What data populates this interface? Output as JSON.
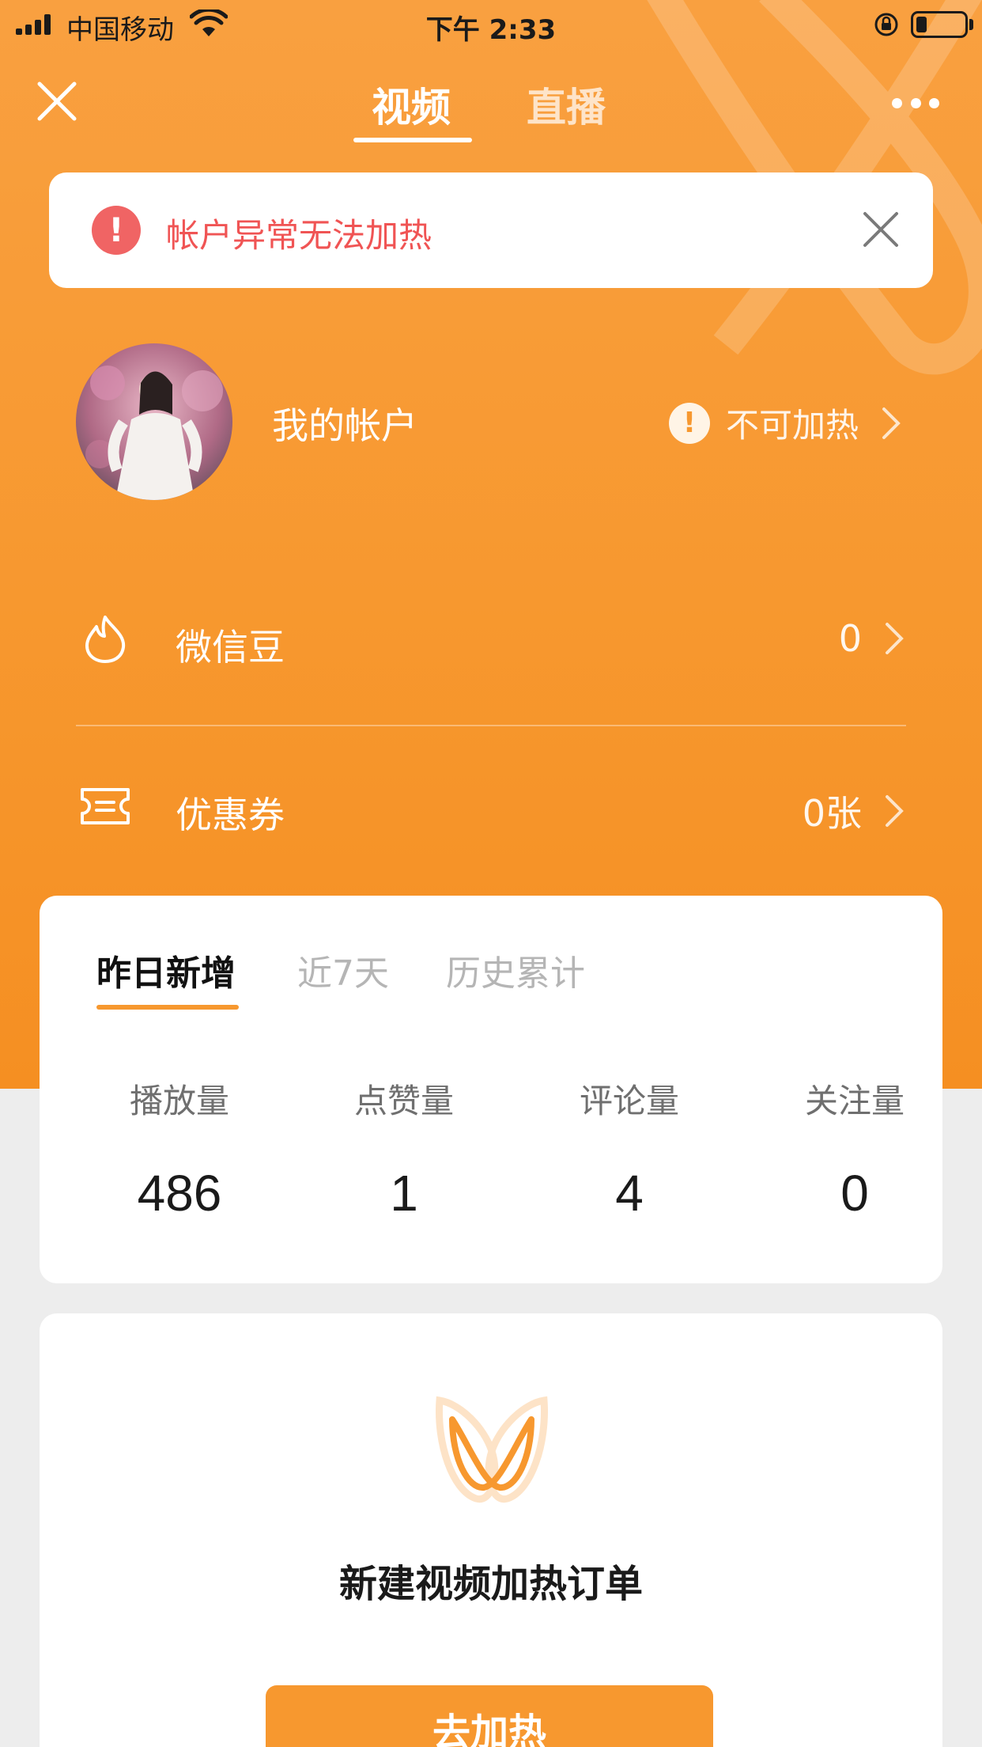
{
  "status_bar": {
    "carrier": "中国移动",
    "time": "下午 2:33",
    "battery_level": 0.22
  },
  "nav": {
    "tabs": [
      {
        "label": "视频",
        "active": true
      },
      {
        "label": "直播",
        "active": false
      }
    ]
  },
  "alert": {
    "icon_glyph": "!",
    "message": "帐户异常无法加热"
  },
  "account": {
    "name": "我的帐户",
    "status_glyph": "!",
    "status_text": "不可加热"
  },
  "rows": {
    "beans": {
      "label": "微信豆",
      "value": "0"
    },
    "coupons": {
      "label": "优惠券",
      "value": "0张"
    }
  },
  "stats": {
    "tabs": [
      "昨日新增",
      "近7天",
      "历史累计"
    ],
    "metrics": [
      {
        "label": "播放量",
        "value": "486"
      },
      {
        "label": "点赞量",
        "value": "1"
      },
      {
        "label": "评论量",
        "value": "4"
      },
      {
        "label": "关注量",
        "value": "0"
      }
    ]
  },
  "order": {
    "title": "新建视频加热订单",
    "button_label": "去加热"
  },
  "colors": {
    "accent": "#f7982f",
    "alert_red": "#f06464",
    "background": "#ededed"
  },
  "icons": [
    "close-icon",
    "more-icon",
    "alert-icon",
    "warning-icon",
    "chevron-right-icon",
    "flame-icon",
    "ticket-icon",
    "butterfly-logo-icon",
    "signal-icon",
    "wifi-icon",
    "orientation-lock-icon",
    "battery-icon"
  ]
}
